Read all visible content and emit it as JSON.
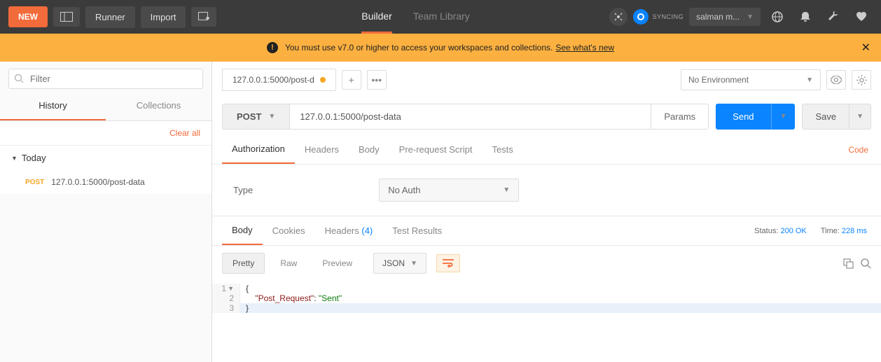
{
  "header": {
    "new_label": "NEW",
    "runner_label": "Runner",
    "import_label": "Import",
    "tabs": {
      "builder": "Builder",
      "team": "Team Library"
    },
    "sync_label": "SYNCING",
    "user_label": "salman m..."
  },
  "banner": {
    "text": "You must use v7.0 or higher to access your workspaces and collections.",
    "link": "See what's new"
  },
  "sidebar": {
    "filter_placeholder": "Filter",
    "tabs": {
      "history": "History",
      "collections": "Collections"
    },
    "clear_all": "Clear all",
    "groups": [
      {
        "label": "Today",
        "items": [
          {
            "method": "POST",
            "url": "127.0.0.1:5000/post-data"
          }
        ]
      }
    ]
  },
  "tabs": {
    "open": [
      {
        "title": "127.0.0.1:5000/post-d",
        "dirty": true
      }
    ],
    "env_label": "No Environment"
  },
  "request": {
    "method": "POST",
    "url": "127.0.0.1:5000/post-data",
    "params_label": "Params",
    "send_label": "Send",
    "save_label": "Save",
    "tabs": {
      "auth": "Authorization",
      "headers": "Headers",
      "body": "Body",
      "prescript": "Pre-request Script",
      "tests": "Tests"
    },
    "code_link": "Code",
    "auth": {
      "type_label": "Type",
      "selected": "No Auth"
    }
  },
  "response": {
    "tabs": {
      "body": "Body",
      "cookies": "Cookies",
      "headers": "Headers",
      "test": "Test Results"
    },
    "header_count": "(4)",
    "status_label": "Status:",
    "status_value": "200 OK",
    "time_label": "Time:",
    "time_value": "228 ms",
    "view": {
      "pretty": "Pretty",
      "raw": "Raw",
      "preview": "Preview",
      "format": "JSON"
    },
    "body_lines": [
      {
        "n": "1",
        "fold": true,
        "t": "{"
      },
      {
        "n": "2",
        "t_key": "\"Post_Request\"",
        "t_sep": ": ",
        "t_val": "\"Sent\""
      },
      {
        "n": "3",
        "t": "}",
        "hl": true
      }
    ]
  }
}
